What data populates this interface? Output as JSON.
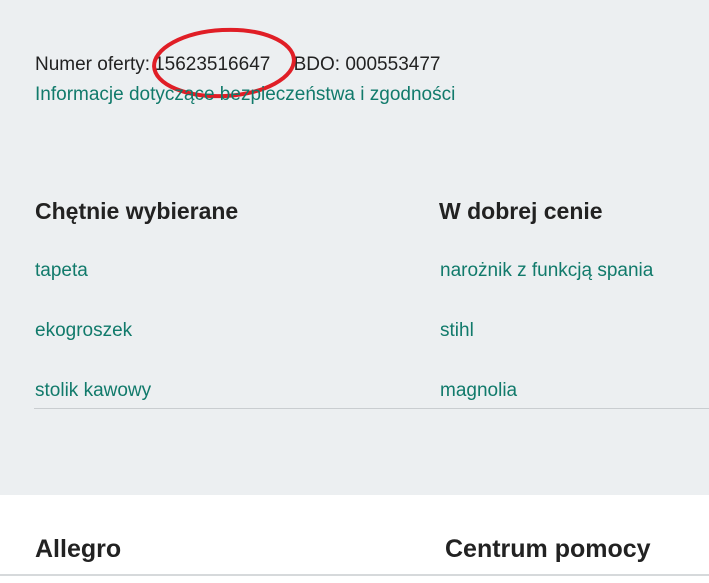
{
  "offer": {
    "number_label": "Numer oferty:",
    "number_value": "15623516647",
    "bdo_text": "BDO: 000553477",
    "safety_link": "Informacje dotyczące bezpieczeństwa i zgodności"
  },
  "annotation": {
    "color": "#e01e26"
  },
  "sections": {
    "popular": {
      "heading": "Chętnie wybierane",
      "links": [
        "tapeta",
        "ekogroszek",
        "stolik kawowy"
      ]
    },
    "good_price": {
      "heading": "W dobrej cenie",
      "links": [
        "narożnik z funkcją spania",
        "stihl",
        "magnolia"
      ]
    }
  },
  "footer": {
    "allegro_heading": "Allegro",
    "help_heading": "Centrum pomocy"
  },
  "colors": {
    "link": "#117a6b",
    "background": "#eceff1",
    "footer_background": "#ffffff"
  }
}
